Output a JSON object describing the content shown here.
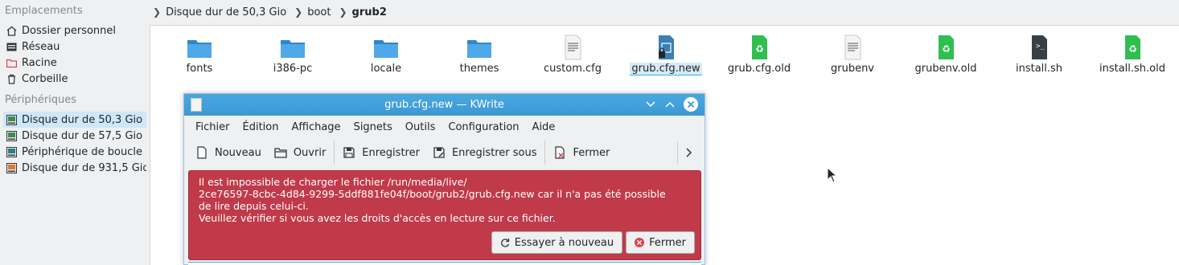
{
  "sidebar": {
    "places_title": "Emplacements",
    "places": [
      {
        "label": "Dossier personnel",
        "icon": "home-icon"
      },
      {
        "label": "Réseau",
        "icon": "network-icon"
      },
      {
        "label": "Racine",
        "icon": "root-folder-icon"
      },
      {
        "label": "Corbeille",
        "icon": "trash-icon"
      }
    ],
    "devices_title": "Périphériques",
    "devices": [
      {
        "label": "Disque dur de 50,3 Gio",
        "icon": "hard-drive-icon",
        "selected": true
      },
      {
        "label": "Disque dur de 57,5 Gio",
        "icon": "hard-drive-icon"
      },
      {
        "label": "Périphérique de boucle",
        "icon": "loop-device-icon"
      },
      {
        "label": "Disque dur de 931,5 Gio",
        "icon": "hard-drive-icon"
      }
    ]
  },
  "breadcrumb": {
    "items": [
      "Disque dur de 50,3 Gio",
      "boot",
      "grub2"
    ]
  },
  "files": [
    {
      "name": "fonts",
      "icon": "folder-icon"
    },
    {
      "name": "i386-pc",
      "icon": "folder-icon"
    },
    {
      "name": "locale",
      "icon": "folder-icon"
    },
    {
      "name": "themes",
      "icon": "folder-icon"
    },
    {
      "name": "custom.cfg",
      "icon": "text-file-icon"
    },
    {
      "name": "grub.cfg.new",
      "icon": "locked-file-icon",
      "selected": true
    },
    {
      "name": "grub.cfg.old",
      "icon": "backup-file-icon"
    },
    {
      "name": "grubenv",
      "icon": "text-file-icon"
    },
    {
      "name": "grubenv.old",
      "icon": "backup-file-icon"
    },
    {
      "name": "install.sh",
      "icon": "script-file-icon"
    },
    {
      "name": "install.sh.old",
      "icon": "backup-file-icon"
    }
  ],
  "kwrite": {
    "title": "grub.cfg.new — KWrite",
    "menu": [
      "Fichier",
      "Édition",
      "Affichage",
      "Signets",
      "Outils",
      "Configuration",
      "Aide"
    ],
    "toolbar": {
      "new": "Nouveau",
      "open": "Ouvrir",
      "save": "Enregistrer",
      "save_as": "Enregistrer sous",
      "close": "Fermer"
    },
    "error": {
      "line1": "Il est impossible de charger le fichier /run/media/live/",
      "line2": "2ce76597-8cbc-4d84-9299-5ddf881fe04f/boot/grub2/grub.cfg.new car il n'a pas été possible",
      "line3": "de lire depuis celui-ci.",
      "line4": "Veuillez vérifier si vous avez les droits d'accès en lecture sur ce fichier.",
      "retry": "Essayer à nouveau",
      "close": "Fermer"
    }
  },
  "colors": {
    "accent": "#3daee9",
    "titlebar": "#3b98d5",
    "error_bg": "#c03a4a",
    "folder": "#3c9ad9",
    "backup_green": "#2fbf4f"
  }
}
